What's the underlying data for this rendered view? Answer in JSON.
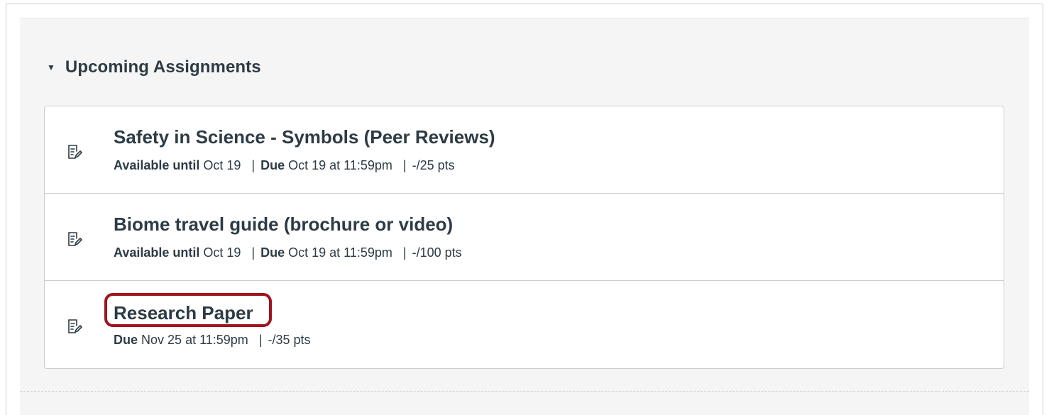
{
  "section": {
    "title": "Upcoming Assignments",
    "expanded": true,
    "caret_icon": "caret-down-icon"
  },
  "assignments": [
    {
      "title": "Safety in Science - Symbols (Peer Reviews)",
      "icon": "assignment-icon",
      "available_label": "Available until",
      "available_value": "Oct 19",
      "due_label": "Due",
      "due_value": "Oct 19 at 11:59pm",
      "points": "-/25 pts",
      "separator": "|"
    },
    {
      "title": "Biome travel guide (brochure or video)",
      "icon": "assignment-icon",
      "available_label": "Available until",
      "available_value": "Oct 19",
      "due_label": "Due",
      "due_value": "Oct 19 at 11:59pm",
      "points": "-/100 pts",
      "separator": "|"
    },
    {
      "title": "Research Paper",
      "icon": "assignment-icon",
      "due_label": "Due",
      "due_value": "Nov 25 at 11:59pm",
      "points": "-/35 pts",
      "separator": "|",
      "highlighted": true
    }
  ],
  "colors": {
    "text": "#2d3b45",
    "border": "#c7cdd1",
    "panel_bg": "#f5f5f5",
    "highlight": "#a0131d"
  }
}
